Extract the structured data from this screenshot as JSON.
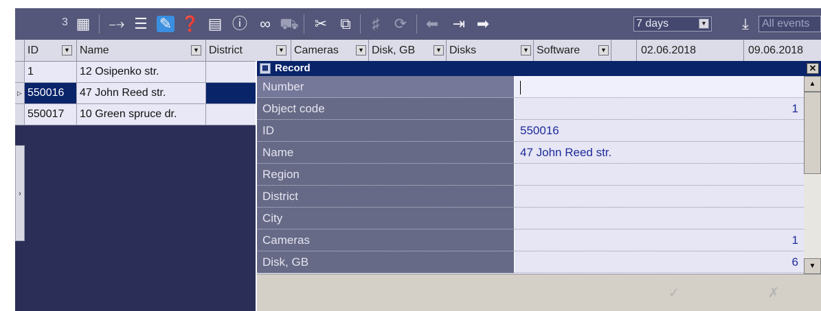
{
  "toolbar": {
    "count": "3",
    "period": "7 days",
    "event_filter": "All events"
  },
  "grid": {
    "columns": [
      "ID",
      "Name",
      "District",
      "Cameras",
      "Disk, GB",
      "Disks",
      "Software"
    ],
    "dates": [
      "02.06.2018",
      "09.06.2018"
    ],
    "rows": [
      {
        "id": "1",
        "name": "12 Osipenko str."
      },
      {
        "id": "550016",
        "name": "47 John Reed str."
      },
      {
        "id": "550017",
        "name": "10 Green spruce dr."
      }
    ]
  },
  "record": {
    "title": "Record",
    "fields": [
      {
        "label": "Number",
        "value": ""
      },
      {
        "label": "Object code",
        "value": "1"
      },
      {
        "label": "ID",
        "value": "550016"
      },
      {
        "label": "Name",
        "value": "47 John Reed str."
      },
      {
        "label": "Region",
        "value": ""
      },
      {
        "label": "District",
        "value": ""
      },
      {
        "label": "City",
        "value": ""
      },
      {
        "label": "Cameras",
        "value": "1"
      },
      {
        "label": "Disk, GB",
        "value": "6"
      }
    ]
  }
}
